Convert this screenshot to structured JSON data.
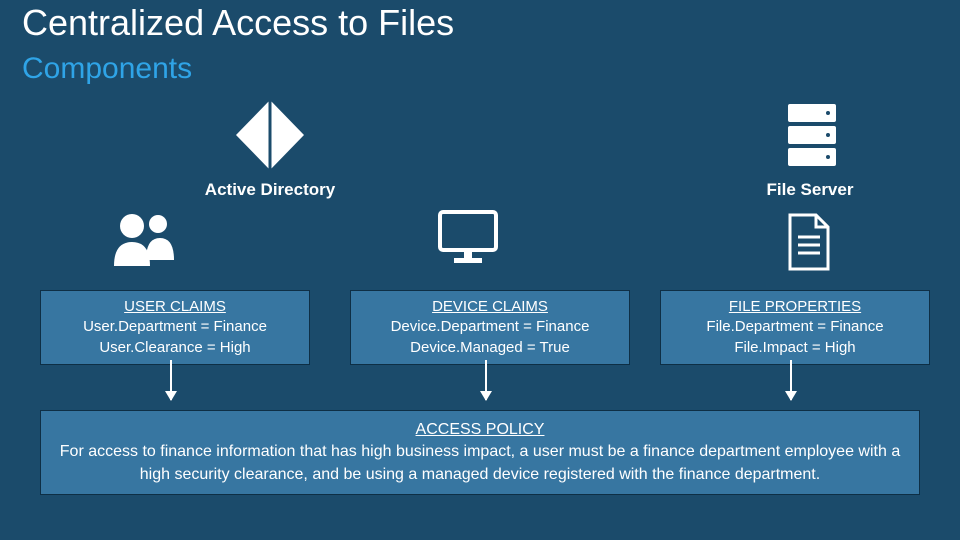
{
  "title": "Centralized Access to Files",
  "subtitle": "Components",
  "labels": {
    "active_directory": "Active Directory",
    "file_server": "File Server"
  },
  "user_claims": {
    "header": "USER CLAIMS",
    "line1": "User.Department = Finance",
    "line2": "User.Clearance = High"
  },
  "device_claims": {
    "header": "DEVICE CLAIMS",
    "line1": "Device.Department = Finance",
    "line2": "Device.Managed = True"
  },
  "file_properties": {
    "header": "FILE PROPERTIES",
    "line1": "File.Department = Finance",
    "line2": "File.Impact = High"
  },
  "access_policy": {
    "header": "ACCESS POLICY",
    "body": "For access to finance information that has high business impact, a user must be a finance department employee with a high security clearance, and be using a managed device registered with the finance department."
  }
}
